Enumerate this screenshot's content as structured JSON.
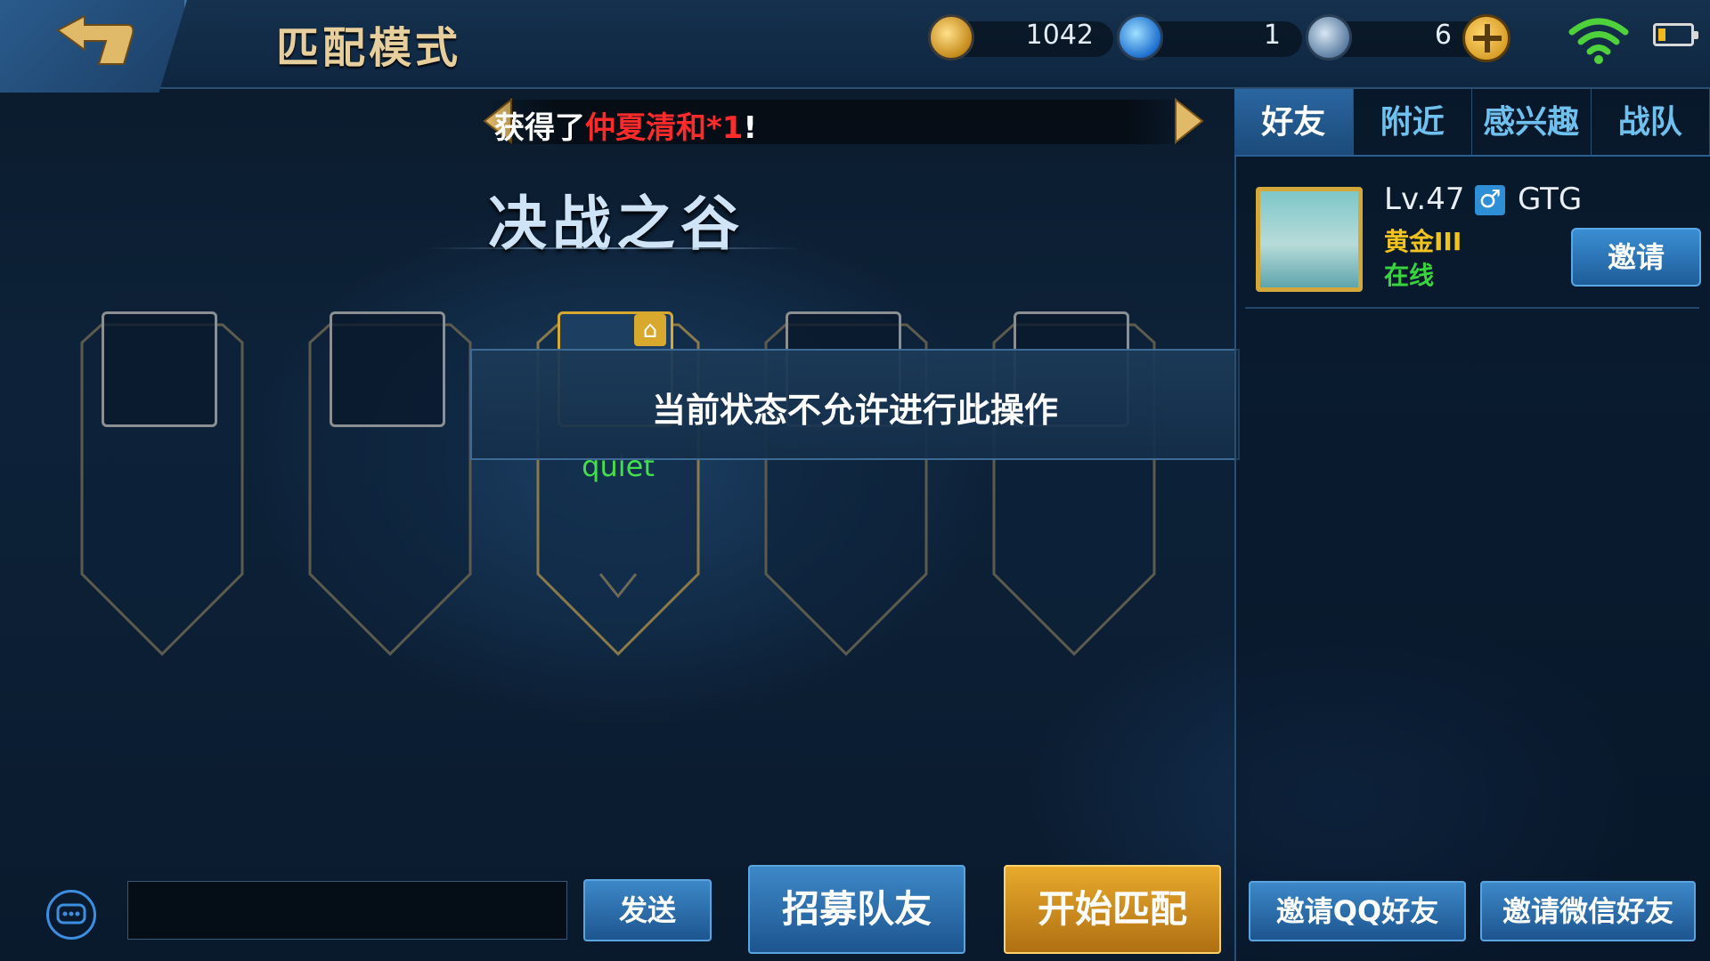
{
  "header": {
    "title": "匹配模式",
    "gold": {
      "icon": "gold-coin-icon",
      "value": "1042"
    },
    "diamond": {
      "icon": "diamond-icon",
      "value": "1"
    },
    "voucher": {
      "icon": "voucher-icon",
      "value": "6"
    },
    "add_icon": "plus-icon",
    "wifi_icon": "wifi-icon",
    "battery_icon": "battery-icon"
  },
  "announcement": {
    "prefix": "获得了",
    "highlight": "仲夏清和*1",
    "suffix": "!"
  },
  "map": {
    "name": "决战之谷"
  },
  "team": {
    "slots": [
      {
        "occupied": false,
        "name": ""
      },
      {
        "occupied": false,
        "name": ""
      },
      {
        "occupied": true,
        "name": "quiet"
      },
      {
        "occupied": false,
        "name": ""
      },
      {
        "occupied": false,
        "name": ""
      }
    ]
  },
  "toast": {
    "message": "当前状态不允许进行此操作"
  },
  "friends_panel": {
    "tabs": [
      "好友",
      "附近",
      "感兴趣",
      "战队"
    ],
    "active_tab": 0,
    "friends": [
      {
        "level": "Lv.47",
        "gender_icon": "male-icon",
        "gender_symbol": "♂",
        "name": "GTG",
        "rank": "黄金III",
        "status": "在线",
        "invite_label": "邀请"
      }
    ]
  },
  "bottom": {
    "chat_placeholder": "",
    "send_label": "发送",
    "recruit_label": "招募队友",
    "start_match_label": "开始匹配",
    "invite_qq_label": "邀请QQ好友",
    "invite_wechat_label": "邀请微信好友"
  },
  "colors": {
    "accent_gold": "#e6cf9d",
    "announce_highlight": "#ff2a2a",
    "online_green": "#38d43e",
    "rank_gold": "#f2c31c",
    "player_name_green": "#42e04a"
  }
}
